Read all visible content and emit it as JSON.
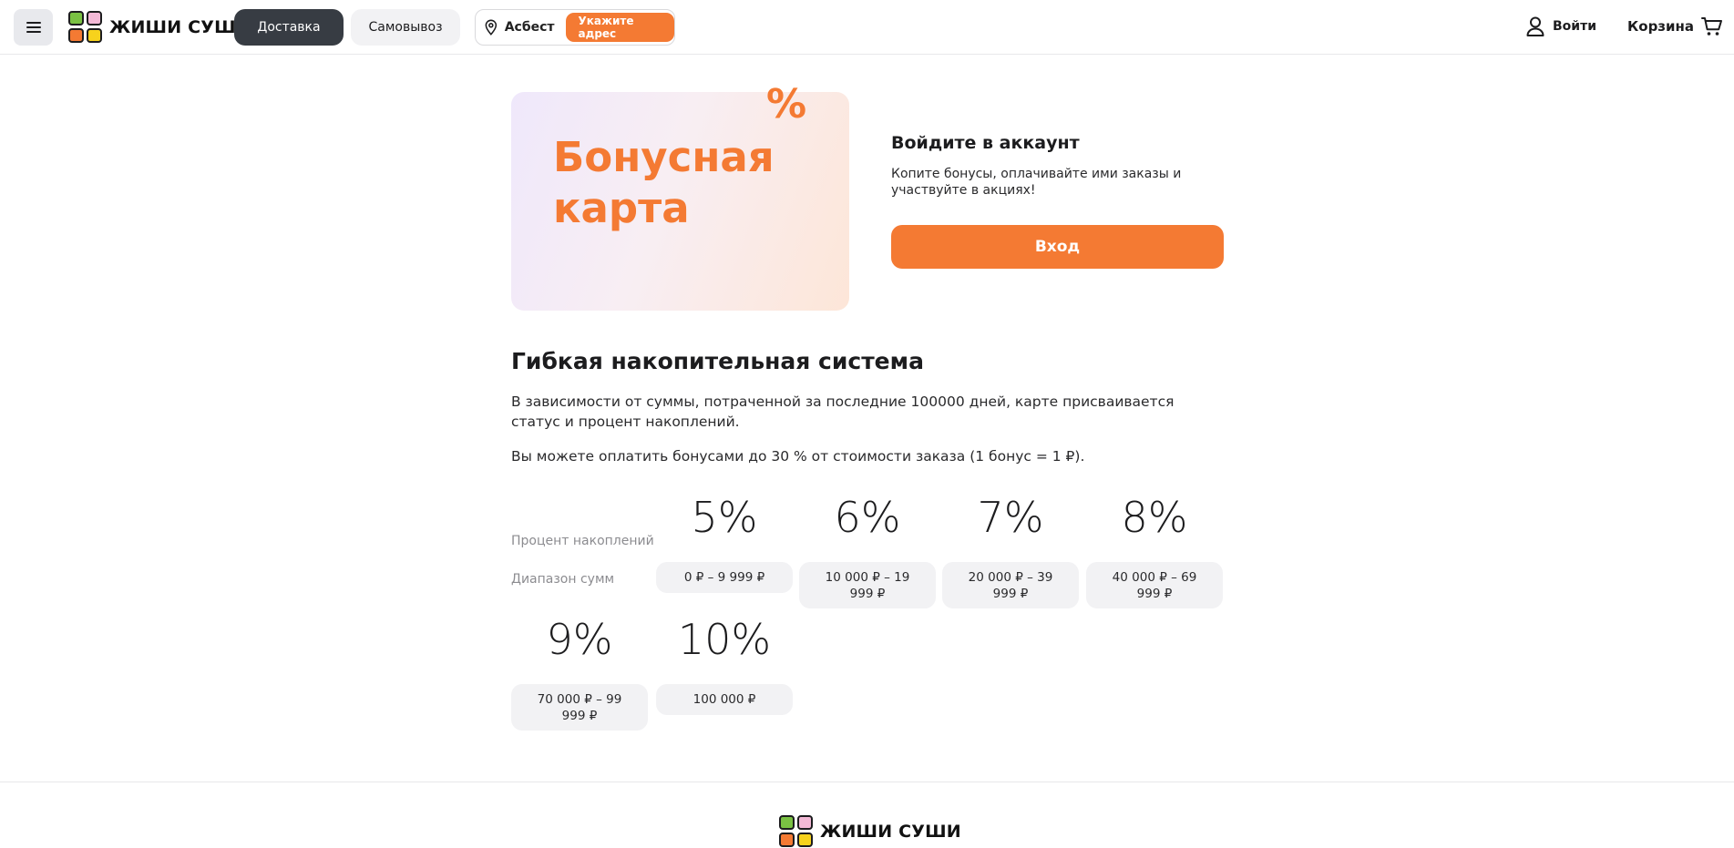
{
  "brand": {
    "name": "ЖИШИ СУШИ",
    "accent_color": "#f47a33",
    "dark_color": "#373c43"
  },
  "header": {
    "menu_icon": "hamburger-icon",
    "delivery_label": "Доставка",
    "pickup_label": "Самовывоз",
    "city": "Асбест",
    "address_cta": "Укажите адрес",
    "login_label": "Войти",
    "cart_label": "Корзина"
  },
  "bonus_card": {
    "title": "Бонусная карта",
    "percent_sign": "%"
  },
  "login_panel": {
    "title": "Войдите в аккаунт",
    "description": "Копите бонусы, оплачивайте ими заказы и участвуйте в акциях!",
    "button_label": "Вход"
  },
  "savings": {
    "title": "Гибкая накопительная система",
    "description": "В зависимости от суммы, потраченной за последние 100000 дней, карте присваивается статус и процент накоплений.",
    "note": "Вы можете оплатить бонусами до 30 % от стоимости заказа (1 бонус = 1 ₽).",
    "percent_label": "Процент накоплений",
    "range_label": "Диапазон сумм",
    "tiers": [
      {
        "percent": "5%",
        "range": "0 ₽ – 9 999 ₽"
      },
      {
        "percent": "6%",
        "range": "10 000 ₽ – 19 999 ₽"
      },
      {
        "percent": "7%",
        "range": "20 000 ₽ – 39 999 ₽"
      },
      {
        "percent": "8%",
        "range": "40 000 ₽ – 69 999 ₽"
      },
      {
        "percent": "9%",
        "range": "70 000 ₽ – 99 999 ₽"
      },
      {
        "percent": "10%",
        "range": "100 000 ₽"
      }
    ]
  },
  "footer": {
    "logo_text": "ЖИШИ СУШИ"
  }
}
